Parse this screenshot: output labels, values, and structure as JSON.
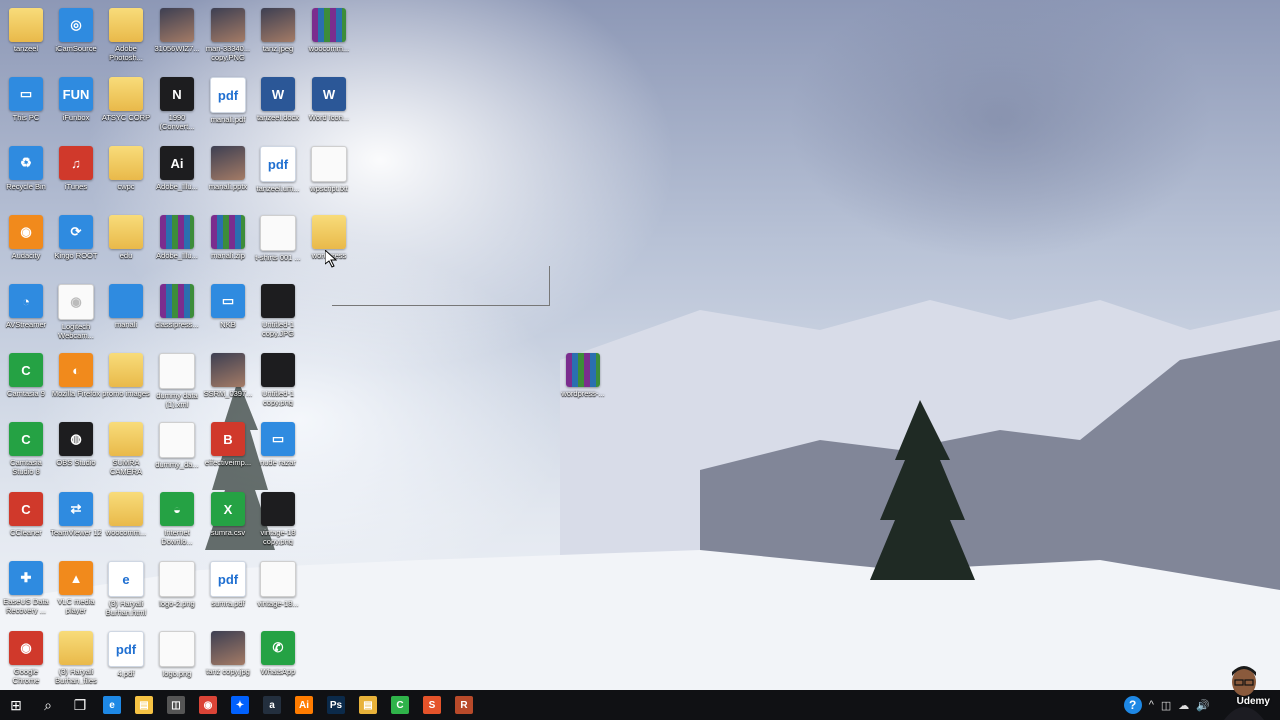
{
  "desktop": {
    "icons": [
      {
        "label": "tanzeel",
        "type": "folder",
        "glyph": "",
        "col": 0,
        "row": 0
      },
      {
        "label": "iCamSource",
        "type": "app",
        "glyph": "◎",
        "col": 1,
        "row": 0
      },
      {
        "label": "Adobe Photosh...",
        "type": "folder",
        "glyph": "",
        "col": 2,
        "row": 0
      },
      {
        "label": "31056WIZ7...",
        "type": "photo",
        "glyph": "",
        "col": 3,
        "row": 0
      },
      {
        "label": "man-33340... copy.PNG",
        "type": "photo",
        "glyph": "",
        "col": 4,
        "row": 0
      },
      {
        "label": "tanz.jpeg",
        "type": "photo",
        "glyph": "",
        "col": 5,
        "row": 0
      },
      {
        "label": "woocomm...",
        "type": "rar",
        "glyph": "",
        "col": 6,
        "row": 0
      },
      {
        "label": "This PC",
        "type": "app",
        "glyph": "▭",
        "col": 0,
        "row": 1
      },
      {
        "label": "iFunbox",
        "type": "app",
        "glyph": "FUN",
        "col": 1,
        "row": 1
      },
      {
        "label": "ATSYC CORP",
        "type": "folder",
        "glyph": "",
        "col": 2,
        "row": 1
      },
      {
        "label": "1990 (Convert...",
        "type": "dark",
        "glyph": "N",
        "col": 3,
        "row": 1
      },
      {
        "label": "manali.pdf",
        "type": "pdf",
        "glyph": "pdf",
        "col": 4,
        "row": 1
      },
      {
        "label": "tanzeel.docx",
        "type": "word",
        "glyph": "W",
        "col": 5,
        "row": 1
      },
      {
        "label": "Word Icon...",
        "type": "word",
        "glyph": "W",
        "col": 6,
        "row": 1
      },
      {
        "label": "Recycle Bin",
        "type": "app",
        "glyph": "♻",
        "col": 0,
        "row": 2
      },
      {
        "label": "iTunes",
        "type": "red",
        "glyph": "♫",
        "col": 1,
        "row": 2
      },
      {
        "label": "cwpc",
        "type": "folder",
        "glyph": "",
        "col": 2,
        "row": 2
      },
      {
        "label": "Adobe_Illu...",
        "type": "dark",
        "glyph": "Ai",
        "col": 3,
        "row": 2
      },
      {
        "label": "manali.pptx",
        "type": "photo",
        "glyph": "",
        "col": 4,
        "row": 2
      },
      {
        "label": "tanzeel.um...",
        "type": "pdf",
        "glyph": "pdf",
        "col": 5,
        "row": 2
      },
      {
        "label": "wpscript.txt",
        "type": "blank",
        "glyph": "",
        "col": 6,
        "row": 2
      },
      {
        "label": "Audacity",
        "type": "orange",
        "glyph": "◉",
        "col": 0,
        "row": 3
      },
      {
        "label": "Kingo ROOT",
        "type": "app",
        "glyph": "⟳",
        "col": 1,
        "row": 3
      },
      {
        "label": "edu",
        "type": "folder",
        "glyph": "",
        "col": 2,
        "row": 3
      },
      {
        "label": "Adobe_Illu...",
        "type": "rar",
        "glyph": "",
        "col": 3,
        "row": 3
      },
      {
        "label": "manali.zip",
        "type": "rar",
        "glyph": "",
        "col": 4,
        "row": 3
      },
      {
        "label": "t-shirts 001 ...",
        "type": "blank",
        "glyph": "",
        "col": 5,
        "row": 3
      },
      {
        "label": "wordpress",
        "type": "folder",
        "glyph": "",
        "col": 6,
        "row": 3
      },
      {
        "label": "AVStreamer",
        "type": "app",
        "glyph": "◔",
        "col": 0,
        "row": 4
      },
      {
        "label": "Logitech Webcam...",
        "type": "blank",
        "glyph": "◉",
        "col": 1,
        "row": 4
      },
      {
        "label": "manali",
        "type": "app",
        "glyph": "",
        "col": 2,
        "row": 4
      },
      {
        "label": "classipress...",
        "type": "rar",
        "glyph": "",
        "col": 3,
        "row": 4
      },
      {
        "label": "NKB",
        "type": "app",
        "glyph": "▭",
        "col": 4,
        "row": 4
      },
      {
        "label": "Untitled-1 copy.JPG",
        "type": "dark",
        "glyph": "",
        "col": 5,
        "row": 4
      },
      {
        "label": "Camtasia 9",
        "type": "green",
        "glyph": "C",
        "col": 0,
        "row": 5
      },
      {
        "label": "Mozilla Firefox",
        "type": "orange",
        "glyph": "◐",
        "col": 1,
        "row": 5
      },
      {
        "label": "promo images",
        "type": "folder",
        "glyph": "",
        "col": 2,
        "row": 5
      },
      {
        "label": "dummy data (1).xml",
        "type": "blank",
        "glyph": "",
        "col": 3,
        "row": 5
      },
      {
        "label": "SSRM_0397...",
        "type": "photo",
        "glyph": "",
        "col": 4,
        "row": 5
      },
      {
        "label": "Untitled-1 copy.png",
        "type": "dark",
        "glyph": "",
        "col": 5,
        "row": 5
      },
      {
        "label": "Camtasia Studio 8",
        "type": "green",
        "glyph": "C",
        "col": 0,
        "row": 6
      },
      {
        "label": "OBS Studio",
        "type": "dark",
        "glyph": "◍",
        "col": 1,
        "row": 6
      },
      {
        "label": "SUMRA CAMERA",
        "type": "folder",
        "glyph": "",
        "col": 2,
        "row": 6
      },
      {
        "label": "dummy_da...",
        "type": "blank",
        "glyph": "",
        "col": 3,
        "row": 6
      },
      {
        "label": "effectiveimp...",
        "type": "red",
        "glyph": "B",
        "col": 4,
        "row": 6
      },
      {
        "label": "nude razar",
        "type": "app",
        "glyph": "▭",
        "col": 5,
        "row": 6
      },
      {
        "label": "CCleaner",
        "type": "red",
        "glyph": "C",
        "col": 0,
        "row": 7
      },
      {
        "label": "TeamViewer 12",
        "type": "app",
        "glyph": "⇄",
        "col": 1,
        "row": 7
      },
      {
        "label": "woocomm...",
        "type": "folder",
        "glyph": "",
        "col": 2,
        "row": 7
      },
      {
        "label": "Internet Downlo...",
        "type": "green",
        "glyph": "◒",
        "col": 3,
        "row": 7
      },
      {
        "label": "sumra.csv",
        "type": "green",
        "glyph": "X",
        "col": 4,
        "row": 7
      },
      {
        "label": "vintage-18 copy.png",
        "type": "dark",
        "glyph": "",
        "col": 5,
        "row": 7
      },
      {
        "label": "EaseUS Data Recovery ...",
        "type": "app",
        "glyph": "✚",
        "col": 0,
        "row": 8
      },
      {
        "label": "VLC media player",
        "type": "orange",
        "glyph": "▲",
        "col": 1,
        "row": 8
      },
      {
        "label": "(3) Haryali Burhan.html",
        "type": "pdf",
        "glyph": "e",
        "col": 2,
        "row": 8
      },
      {
        "label": "logo-2.png",
        "type": "blank",
        "glyph": "",
        "col": 3,
        "row": 8
      },
      {
        "label": "sumra.pdf",
        "type": "pdf",
        "glyph": "pdf",
        "col": 4,
        "row": 8
      },
      {
        "label": "vintage-18...",
        "type": "blank",
        "glyph": "",
        "col": 5,
        "row": 8
      },
      {
        "label": "Google Chrome",
        "type": "red",
        "glyph": "◉",
        "col": 0,
        "row": 9
      },
      {
        "label": "(3) Haryali Burhan_files",
        "type": "folder",
        "glyph": "",
        "col": 1,
        "row": 9
      },
      {
        "label": "4.pdf",
        "type": "pdf",
        "glyph": "pdf",
        "col": 2,
        "row": 9
      },
      {
        "label": "logo.png",
        "type": "blank",
        "glyph": "",
        "col": 3,
        "row": 9
      },
      {
        "label": "tanz copy.jpg",
        "type": "photo",
        "glyph": "",
        "col": 4,
        "row": 9
      },
      {
        "label": "WhatsApp",
        "type": "green",
        "glyph": "✆",
        "col": 5,
        "row": 9
      }
    ],
    "floating_icon": {
      "label": "wordpress-...",
      "type": "rar",
      "glyph": ""
    }
  },
  "taskbar": {
    "items": [
      {
        "name": "start-button",
        "glyph": "⊞",
        "color": "",
        "type": "system"
      },
      {
        "name": "search-icon",
        "glyph": "⌕",
        "color": "",
        "type": "system"
      },
      {
        "name": "task-view-icon",
        "glyph": "❐",
        "color": "",
        "type": "system"
      },
      {
        "name": "edge-icon",
        "glyph": "e",
        "color": "#1e88e5",
        "type": "app"
      },
      {
        "name": "file-explorer-icon",
        "glyph": "▤",
        "color": "#f6c344",
        "type": "app"
      },
      {
        "name": "store-icon",
        "glyph": "◫",
        "color": "#555555",
        "type": "app"
      },
      {
        "name": "chrome-icon",
        "glyph": "◉",
        "color": "#db4437",
        "type": "app"
      },
      {
        "name": "dropbox-icon",
        "glyph": "✦",
        "color": "#0061fe",
        "type": "app"
      },
      {
        "name": "amazon-icon",
        "glyph": "a",
        "color": "#232f3e",
        "type": "app"
      },
      {
        "name": "illustrator-icon",
        "glyph": "Ai",
        "color": "#ff7c00",
        "type": "app"
      },
      {
        "name": "photoshop-icon",
        "glyph": "Ps",
        "color": "#0b2a4a",
        "type": "app"
      },
      {
        "name": "folder-icon",
        "glyph": "▤",
        "color": "#e8b23a",
        "type": "app"
      },
      {
        "name": "camtasia-icon",
        "glyph": "C",
        "color": "#2fb34a",
        "type": "app"
      },
      {
        "name": "snagit-icon",
        "glyph": "S",
        "color": "#e4532a",
        "type": "app"
      },
      {
        "name": "winrar-icon",
        "glyph": "R",
        "color": "#b84a2a",
        "type": "app"
      }
    ],
    "tray": [
      "?",
      "^",
      "◫",
      "☁",
      "🔊"
    ]
  },
  "watermark": {
    "text": "Udemy"
  }
}
